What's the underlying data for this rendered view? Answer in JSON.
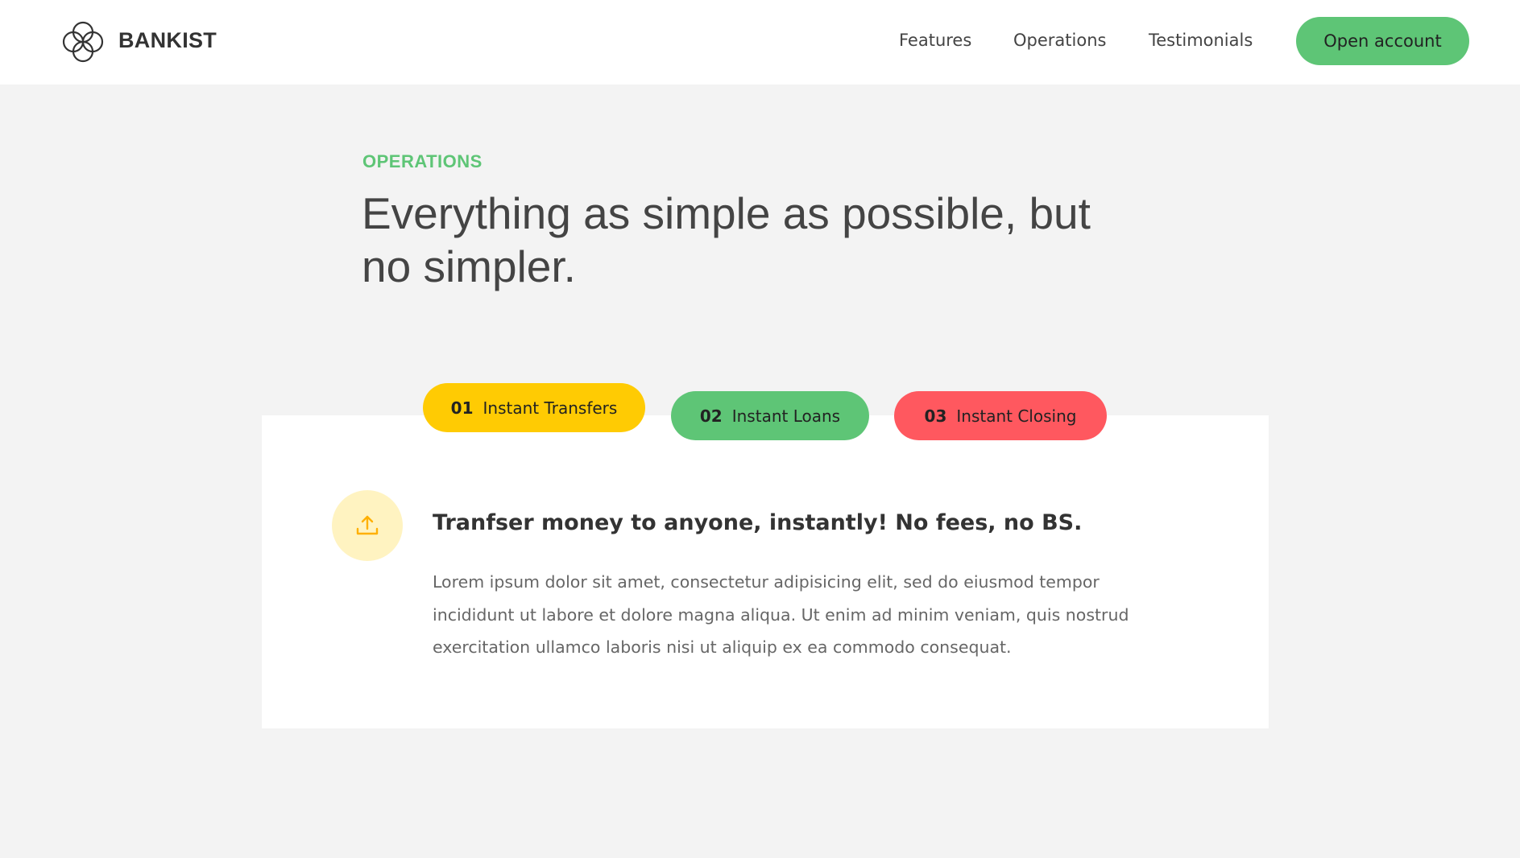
{
  "nav": {
    "brand": "BANKIST",
    "links": [
      "Features",
      "Operations",
      "Testimonials"
    ],
    "cta": "Open account"
  },
  "section": {
    "kicker": "OPERATIONS",
    "title": "Everything as simple as possible, but no simpler."
  },
  "tabs": [
    {
      "num": "01",
      "label": "Instant Transfers",
      "color": "#ffcb03"
    },
    {
      "num": "02",
      "label": "Instant Loans",
      "color": "#5ec576"
    },
    {
      "num": "03",
      "label": "Instant Closing",
      "color": "#ff585f"
    }
  ],
  "content": {
    "icon": "upload-icon",
    "heading": "Tranfser money to anyone, instantly! No fees, no BS.",
    "body": "Lorem ipsum dolor sit amet, consectetur adipisicing elit, sed do eiusmod tempor incididunt ut labore et dolore magna aliqua. Ut enim ad minim veniam, quis nostrud exercitation ullamco laboris nisi ut aliquip ex ea commodo consequat."
  },
  "colors": {
    "accent_green": "#5ec576",
    "accent_yellow": "#ffcb03",
    "accent_red": "#ff585f",
    "background": "#f3f3f3"
  }
}
